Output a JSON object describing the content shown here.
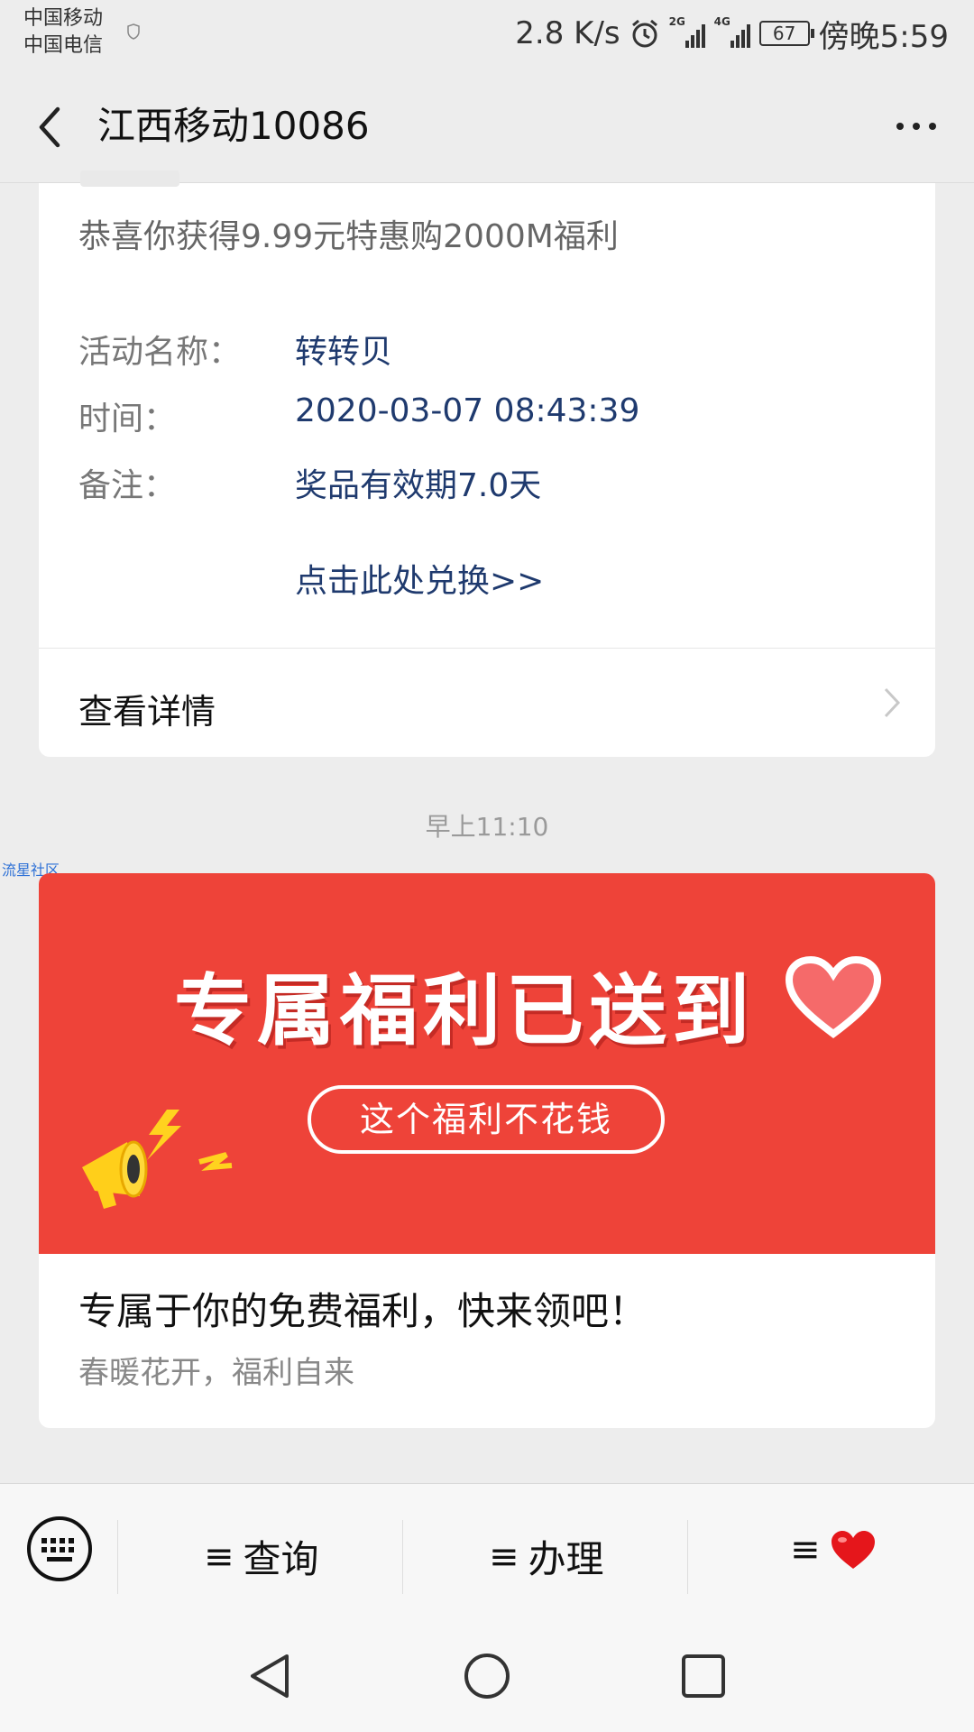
{
  "status_bar": {
    "carrier_1": "中国移动",
    "carrier_2": "中国电信",
    "net_speed": "2.8 K/s",
    "signal_1_label": "2G",
    "signal_2_label": "4G",
    "battery": "67",
    "time": "傍晚5:59"
  },
  "header": {
    "title": "江西移动10086"
  },
  "card1": {
    "intro": "恭喜你获得9.99元特惠购2000M福利",
    "rows": [
      {
        "label": "活动名称：",
        "value": "转转贝"
      },
      {
        "label": "时间：",
        "value": "2020-03-07 08:43:39"
      },
      {
        "label": "备注：",
        "value": "奖品有效期7.0天"
      }
    ],
    "link": "点击此处兑换>>",
    "details": "查看详情"
  },
  "timestamp": "早上11:10",
  "watermark": "流星社区",
  "card2": {
    "banner_title": "专属福利已送到",
    "banner_pill": "这个福利不花钱",
    "title": "专属于你的免费福利，快来领吧！",
    "subtitle": "春暖花开，福利自来"
  },
  "menu": {
    "items": [
      {
        "prefix": "≡",
        "label": "查询"
      },
      {
        "prefix": "≡",
        "label": "办理"
      },
      {
        "prefix": "≡",
        "icon": "heart-icon"
      }
    ]
  },
  "colors": {
    "link": "#1f3a6e",
    "banner": "#ee4339",
    "background": "#ededed"
  }
}
